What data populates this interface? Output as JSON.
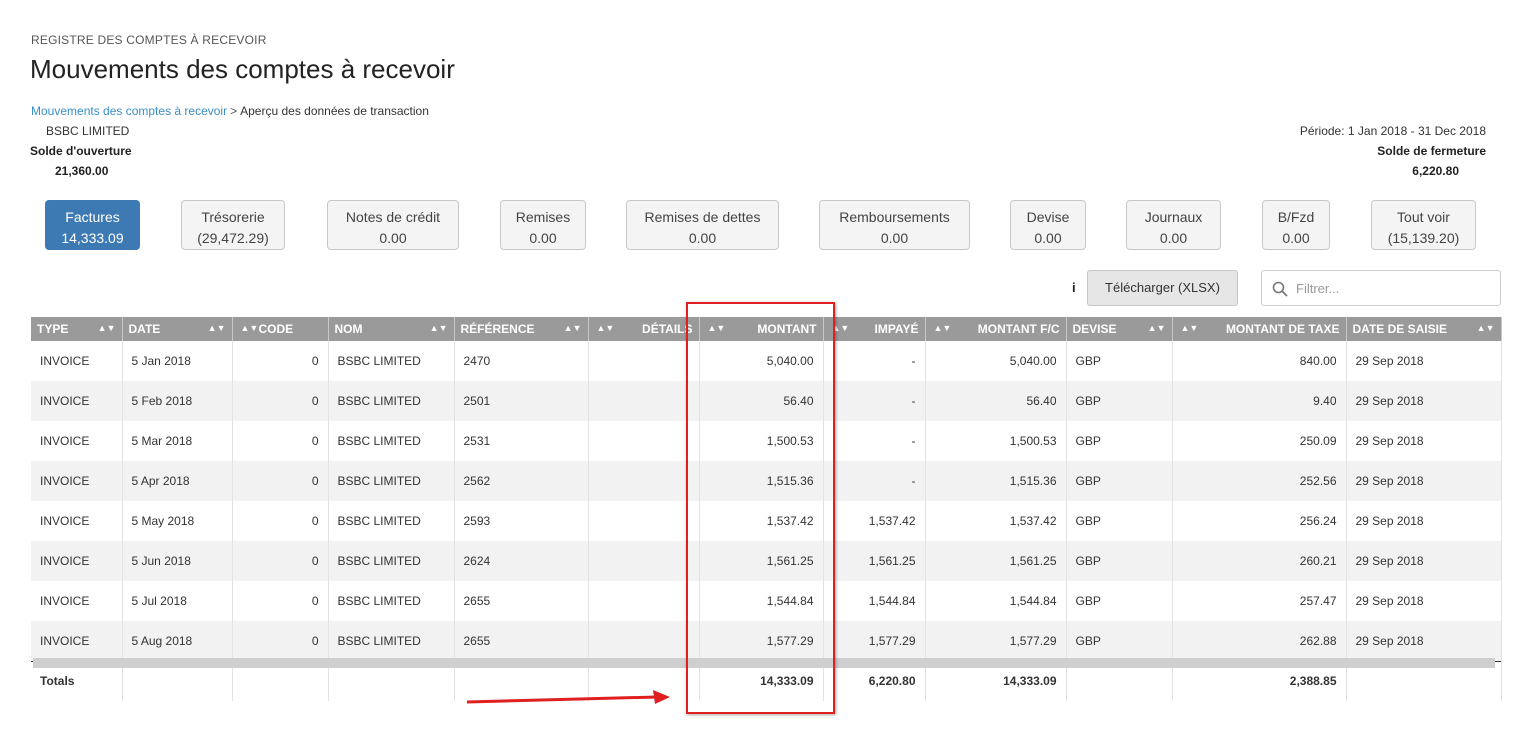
{
  "header": {
    "eyebrow": "REGISTRE DES COMPTES À RECEVOIR",
    "title": "Mouvements des comptes à recevoir"
  },
  "breadcrumb": {
    "link": "Mouvements des comptes à recevoir",
    "separator": ">",
    "current": "Aperçu des données de transaction"
  },
  "summary": {
    "company": "BSBC LIMITED",
    "opening_label": "Solde d'ouverture",
    "opening_value": "21,360.00",
    "period": "Période: 1 Jan 2018 - 31 Dec 2018",
    "closing_label": "Solde de fermeture",
    "closing_value": "6,220.80"
  },
  "tabs": [
    {
      "label": "Factures",
      "value": "14,333.09",
      "active": true
    },
    {
      "label": "Trésorerie",
      "value": "(29,472.29)"
    },
    {
      "label": "Notes de crédit",
      "value": "0.00"
    },
    {
      "label": "Remises",
      "value": "0.00"
    },
    {
      "label": "Remises de dettes",
      "value": "0.00"
    },
    {
      "label": "Remboursements",
      "value": "0.00"
    },
    {
      "label": "Devise",
      "value": "0.00"
    },
    {
      "label": "Journaux",
      "value": "0.00"
    },
    {
      "label": "B/Fzd",
      "value": "0.00"
    },
    {
      "label": "Tout voir",
      "value": "(15,139.20)"
    }
  ],
  "toolbar": {
    "info": "i",
    "download_label": "Télécharger (XLSX)",
    "filter_placeholder": "Filtrer..."
  },
  "table": {
    "columns": [
      "TYPE",
      "DATE",
      "CODE",
      "NOM",
      "RÉFÉRENCE",
      "DÉTAILS",
      "MONTANT",
      "IMPAYÉ",
      "MONTANT F/C",
      "DEVISE",
      "MONTANT DE TAXE",
      "DATE DE SAISIE"
    ],
    "rows": [
      [
        "INVOICE",
        "5 Jan 2018",
        "0",
        "BSBC LIMITED",
        "2470",
        "",
        "5,040.00",
        "-",
        "5,040.00",
        "GBP",
        "840.00",
        "29 Sep 2018"
      ],
      [
        "INVOICE",
        "5 Feb 2018",
        "0",
        "BSBC LIMITED",
        "2501",
        "",
        "56.40",
        "-",
        "56.40",
        "GBP",
        "9.40",
        "29 Sep 2018"
      ],
      [
        "INVOICE",
        "5 Mar 2018",
        "0",
        "BSBC LIMITED",
        "2531",
        "",
        "1,500.53",
        "-",
        "1,500.53",
        "GBP",
        "250.09",
        "29 Sep 2018"
      ],
      [
        "INVOICE",
        "5 Apr 2018",
        "0",
        "BSBC LIMITED",
        "2562",
        "",
        "1,515.36",
        "-",
        "1,515.36",
        "GBP",
        "252.56",
        "29 Sep 2018"
      ],
      [
        "INVOICE",
        "5 May 2018",
        "0",
        "BSBC LIMITED",
        "2593",
        "",
        "1,537.42",
        "1,537.42",
        "1,537.42",
        "GBP",
        "256.24",
        "29 Sep 2018"
      ],
      [
        "INVOICE",
        "5 Jun 2018",
        "0",
        "BSBC LIMITED",
        "2624",
        "",
        "1,561.25",
        "1,561.25",
        "1,561.25",
        "GBP",
        "260.21",
        "29 Sep 2018"
      ],
      [
        "INVOICE",
        "5 Jul 2018",
        "0",
        "BSBC LIMITED",
        "2655",
        "",
        "1,544.84",
        "1,544.84",
        "1,544.84",
        "GBP",
        "257.47",
        "29 Sep 2018"
      ],
      [
        "INVOICE",
        "5 Aug 2018",
        "0",
        "BSBC LIMITED",
        "2655",
        "",
        "1,577.29",
        "1,577.29",
        "1,577.29",
        "GBP",
        "262.88",
        "29 Sep 2018"
      ]
    ],
    "totals": {
      "label": "Totals",
      "montant": "14,333.09",
      "impaye": "6,220.80",
      "montant_fc": "14,333.09",
      "taxe": "2,388.85"
    }
  },
  "colors": {
    "active_tab": "#3d7ab3",
    "header_bg": "#9a9a9a",
    "highlight": "#e02020",
    "link": "#3a8fc8"
  }
}
